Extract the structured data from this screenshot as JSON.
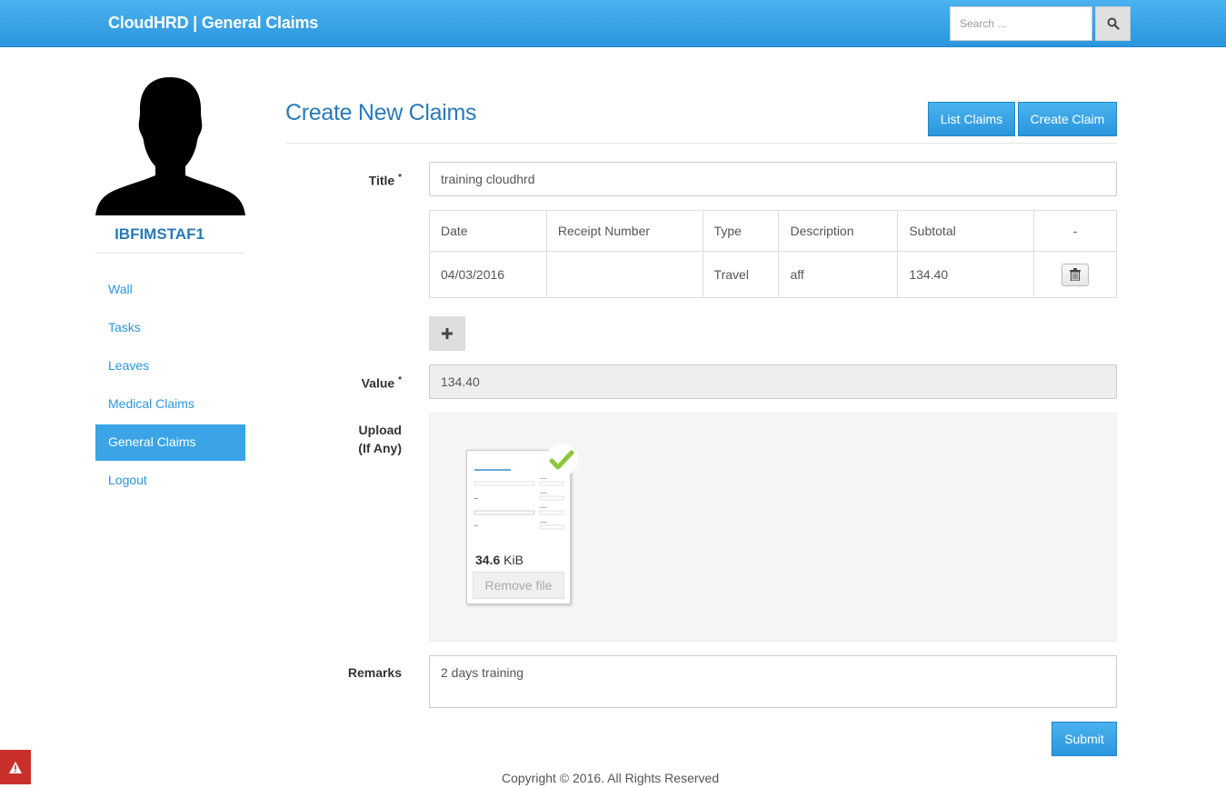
{
  "header": {
    "brand": "CloudHRD | General Claims",
    "search_placeholder": "Search ...",
    "search_icon": "magnifier-icon"
  },
  "sidebar": {
    "username": "IBFIMSTAF1",
    "items": [
      {
        "label": "Wall",
        "active": false
      },
      {
        "label": "Tasks",
        "active": false
      },
      {
        "label": "Leaves",
        "active": false
      },
      {
        "label": "Medical Claims",
        "active": false
      },
      {
        "label": "General Claims",
        "active": true
      },
      {
        "label": "Logout",
        "active": false
      }
    ]
  },
  "main": {
    "title": "Create New Claims",
    "list_claims_label": "List Claims",
    "create_claim_label": "Create Claim",
    "title_label": "Title",
    "title_value": "training cloudhrd",
    "table": {
      "headers": [
        "Date",
        "Receipt Number",
        "Type",
        "Description",
        "Subtotal",
        "-"
      ],
      "rows": [
        {
          "date": "04/03/2016",
          "receipt": "",
          "type": "Travel",
          "description": "aff",
          "subtotal": "134.40"
        }
      ]
    },
    "value_label": "Value",
    "value_value": "134.40",
    "upload_label_1": "Upload",
    "upload_label_2": "(If Any)",
    "file": {
      "size_number": "34.6",
      "size_unit": "KiB",
      "remove_label": "Remove file"
    },
    "remarks_label": "Remarks",
    "remarks_value": "2 days training",
    "submit_label": "Submit",
    "required_mark": "*"
  },
  "footer": {
    "copyright": "Copyright © 2016. All Rights Reserved"
  },
  "colors": {
    "primary": "#2a96dc",
    "title": "#2a7ab8",
    "success_check": "#8cc63f",
    "alert": "#c9302c"
  }
}
